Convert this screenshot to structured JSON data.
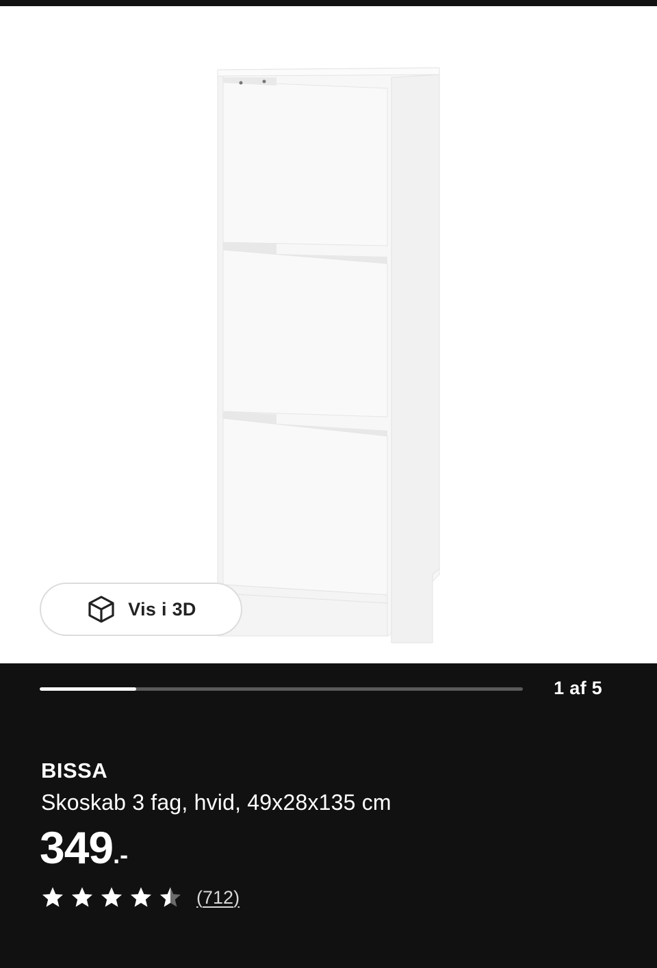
{
  "gallery": {
    "image_description_icon": "shoe-cabinet-image",
    "view_3d_label": "Vis i 3D",
    "view_3d_icon": "cube-icon",
    "progress_fraction": 0.2,
    "page_indicator": "1 af 5"
  },
  "product": {
    "name": "BISSA",
    "description": "Skoskab 3 fag, hvid, 49x28x135 cm",
    "price_integer": "349",
    "price_suffix": ".-",
    "rating_value": 4.5,
    "rating_max": 5,
    "review_count": "712",
    "review_open": "(",
    "review_close": ")"
  },
  "colors": {
    "background": "#111111",
    "gallery_background": "#ffffff",
    "text": "#ffffff"
  }
}
